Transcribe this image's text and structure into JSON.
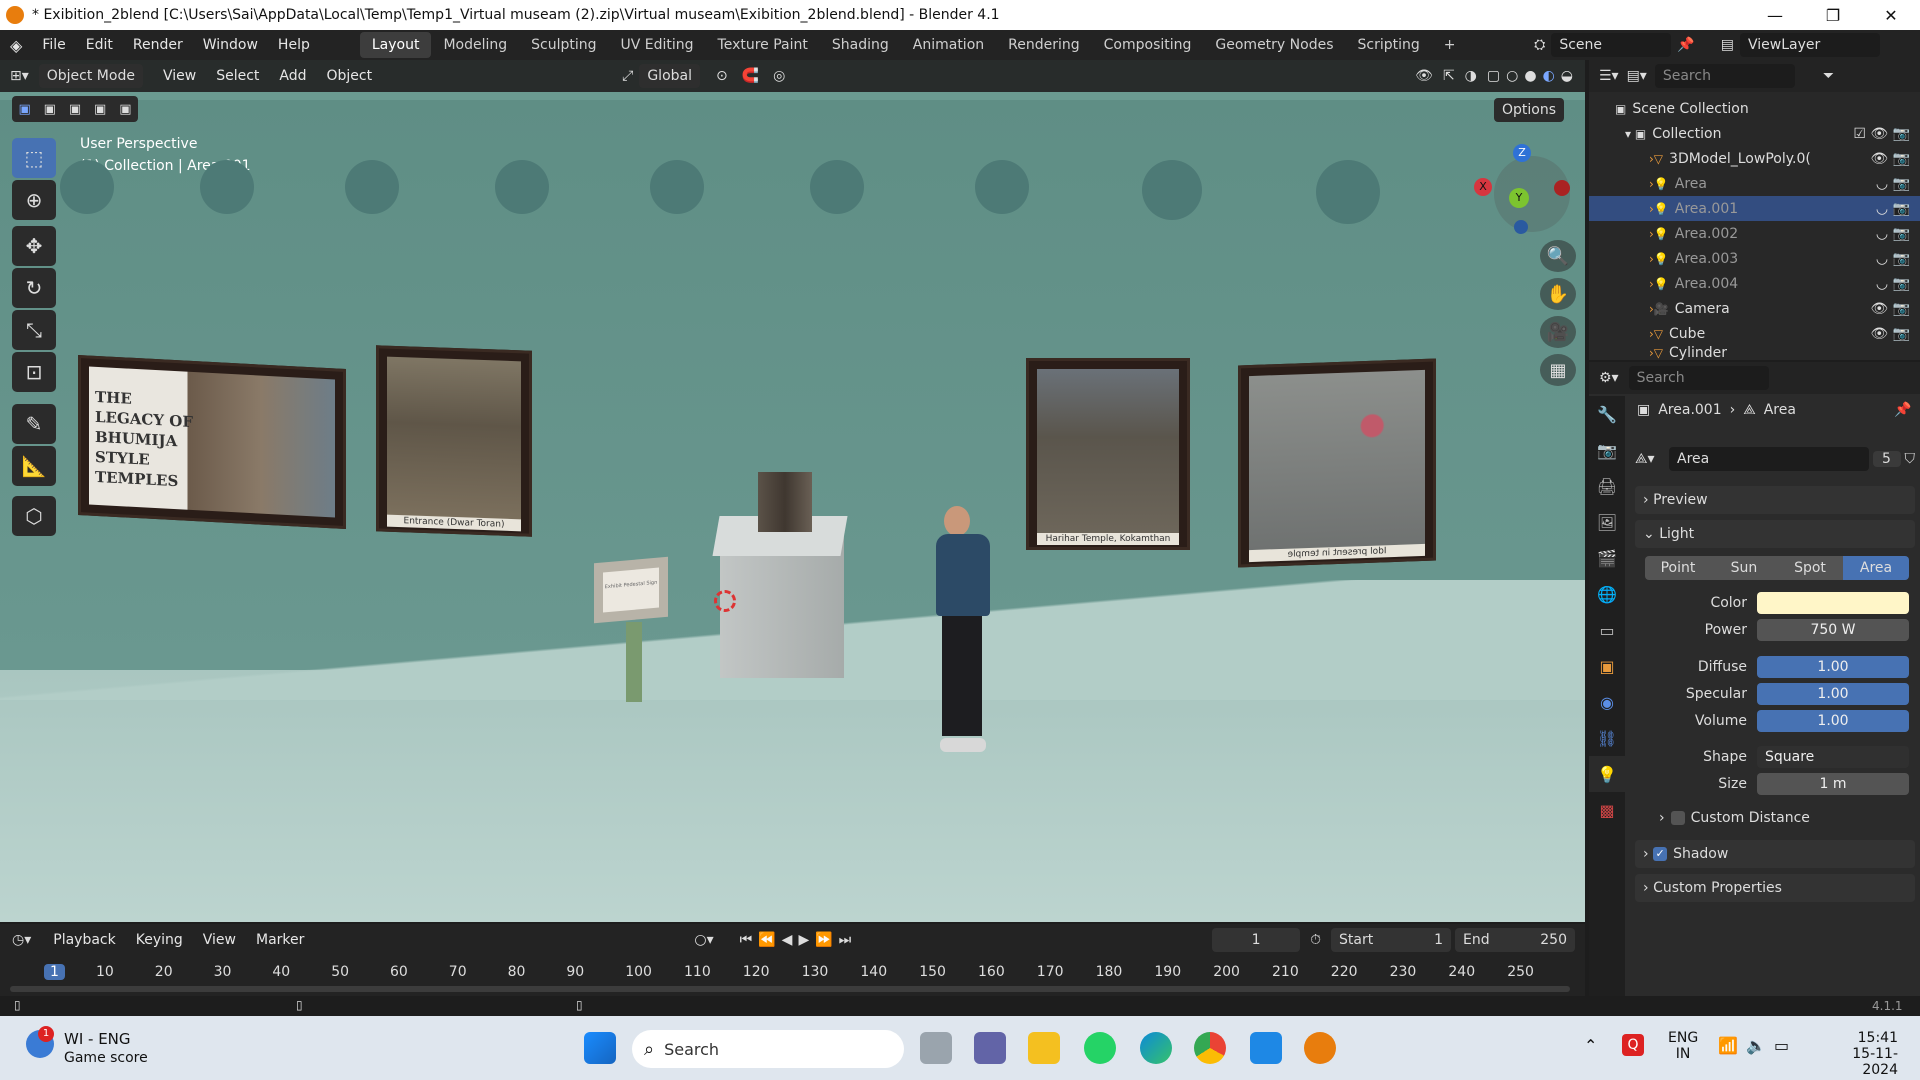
{
  "titlebar": {
    "title": "* Exibition_2blend [C:\\Users\\Sai\\AppData\\Local\\Temp\\Temp1_Virtual museam (2).zip\\Virtual museam\\Exibition_2blend.blend] - Blender 4.1",
    "minimize": "—",
    "maximize": "❐",
    "close": "✕"
  },
  "menu": {
    "items": [
      "File",
      "Edit",
      "Render",
      "Window",
      "Help"
    ]
  },
  "workspaces": [
    "Layout",
    "Modeling",
    "Sculpting",
    "UV Editing",
    "Texture Paint",
    "Shading",
    "Animation",
    "Rendering",
    "Compositing",
    "Geometry Nodes",
    "Scripting"
  ],
  "active_workspace": "Layout",
  "add_workspace": "+",
  "scene": "Scene",
  "view_layer": "ViewLayer",
  "viewport": {
    "mode": "Object Mode",
    "menus": [
      "View",
      "Select",
      "Add",
      "Object"
    ],
    "transform": "Global",
    "options": "Options",
    "overlay_title": "User Perspective",
    "overlay_sub": "(1) Collection | Area.001",
    "gizmo": {
      "x": "X",
      "y": "Y",
      "z": "Z"
    },
    "frames": [
      {
        "title": "THE LEGACY OF BHUMIJA STYLE TEMPLES",
        "caption": ""
      },
      {
        "caption": "Entrance (Dwar Toran)"
      },
      {
        "caption": "Harihar Temple, Kokamthan"
      },
      {
        "caption": "Idol present in temple"
      }
    ],
    "sign_text": "Exhibit Pedestal Sign"
  },
  "outliner": {
    "search_placeholder": "Search",
    "scene_collection": "Scene Collection",
    "collection": "Collection",
    "items": [
      "3DModel_LowPoly.0(",
      "Area",
      "Area.001",
      "Area.002",
      "Area.003",
      "Area.004",
      "Camera",
      "Cube",
      "Cylinder"
    ]
  },
  "properties": {
    "search_placeholder": "Search",
    "breadcrumb_obj": "Area.001",
    "breadcrumb_data": "Area",
    "data_name": "Area",
    "users": "5",
    "preview": "Preview",
    "light": "Light",
    "light_types": [
      "Point",
      "Sun",
      "Spot",
      "Area"
    ],
    "active_type": "Area",
    "color_label": "Color",
    "color_value": "#fff6c8",
    "power_label": "Power",
    "power": "750 W",
    "diffuse_label": "Diffuse",
    "diffuse": "1.00",
    "specular_label": "Specular",
    "specular": "1.00",
    "volume_label": "Volume",
    "volume": "1.00",
    "shape_label": "Shape",
    "shape": "Square",
    "size_label": "Size",
    "size": "1 m",
    "custom_distance": "Custom Distance",
    "shadow": "Shadow",
    "custom_props": "Custom Properties"
  },
  "timeline": {
    "menus": [
      "Playback",
      "Keying",
      "View",
      "Marker"
    ],
    "current_frame": "1",
    "start_label": "Start",
    "start": "1",
    "end_label": "End",
    "end": "250",
    "ticks": [
      "1",
      "10",
      "20",
      "30",
      "40",
      "50",
      "60",
      "70",
      "80",
      "90",
      "100",
      "110",
      "120",
      "130",
      "140",
      "150",
      "160",
      "170",
      "180",
      "190",
      "200",
      "210",
      "220",
      "230",
      "240",
      "250"
    ]
  },
  "status": {
    "version": "4.1.1"
  },
  "taskbar": {
    "widget_title": "WI - ENG",
    "widget_sub": "Game score",
    "badge": "1",
    "search": "Search",
    "lang": "ENG",
    "region": "IN",
    "time": "15:41",
    "date": "15-11-2024"
  }
}
